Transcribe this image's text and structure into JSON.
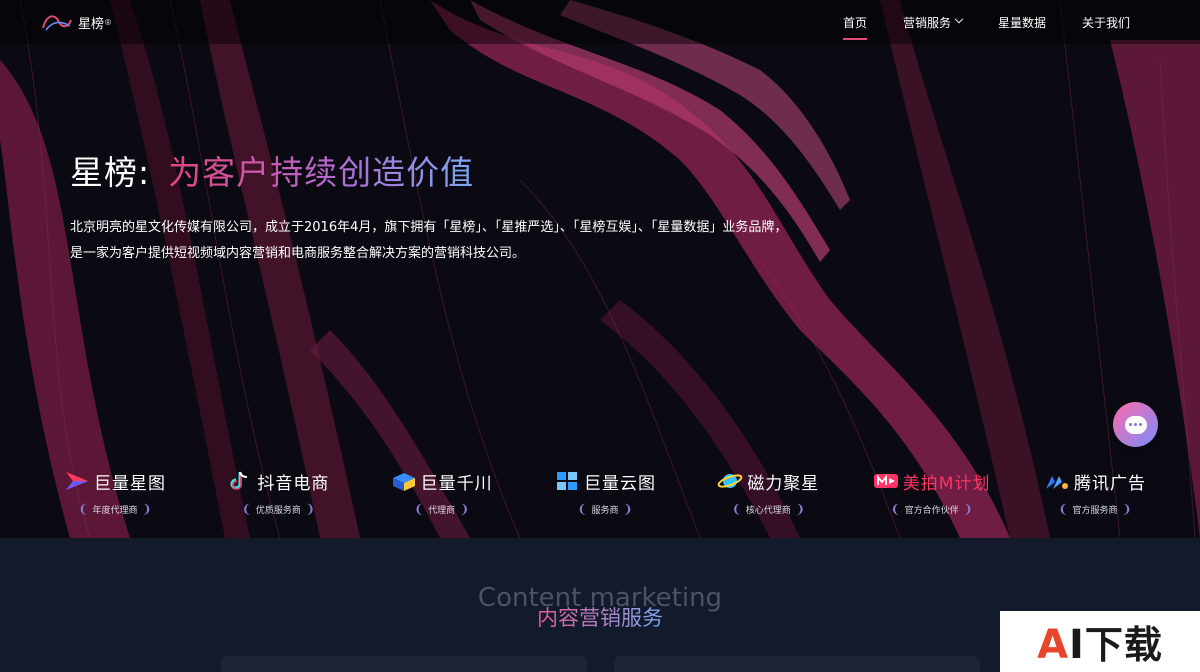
{
  "nav": {
    "logo_text": "星榜",
    "logo_sup": "®",
    "items": [
      {
        "label": "首页",
        "active": true
      },
      {
        "label": "营销服务",
        "has_dropdown": true
      },
      {
        "label": "星量数据"
      },
      {
        "label": "关于我们"
      }
    ]
  },
  "hero": {
    "title_plain": "星榜:",
    "title_gradient": "为客户持续创造价值",
    "desc_line1": "北京明亮的星文化传媒有限公司，成立于2016年4月，旗下拥有「星榜」、「星推严选」、「星榜互娱」、「星量数据」业务品牌，",
    "desc_line2": "是一家为客户提供短视频域内容营销和电商服务整合解决方案的营销科技公司。"
  },
  "partners": [
    {
      "name": "巨量星图",
      "tag": "年度代理商",
      "icon": "xingtu-icon",
      "color": "#ff3b5b"
    },
    {
      "name": "抖音电商",
      "tag": "优质服务商",
      "icon": "douyin-icon",
      "color": "#25f4ee"
    },
    {
      "name": "巨量千川",
      "tag": "代理商",
      "icon": "qianchuan-icon",
      "color": "#3a8bff"
    },
    {
      "name": "巨量云图",
      "tag": "服务商",
      "icon": "yuntu-icon",
      "color": "#2b9bff"
    },
    {
      "name": "磁力聚星",
      "tag": "核心代理商",
      "icon": "cili-icon",
      "color": "#35c4ff"
    },
    {
      "name": "美拍M计划",
      "tag": "官方合作伙伴",
      "icon": "meipai-icon",
      "color": "#ff3366"
    },
    {
      "name": "腾讯广告",
      "tag": "官方服务商",
      "icon": "tencent-ads-icon",
      "color": "#2e7bff"
    }
  ],
  "chat": {
    "icon": "chat-bubble-icon"
  },
  "section": {
    "title_en": "Content marketing",
    "title_cn": "内容营销服务"
  },
  "watermark": {
    "a": "A",
    "i": "I",
    "cn": "下载"
  },
  "colors": {
    "accent": "#e04c76",
    "bg_dark": "#0b0b14",
    "section_bg": "#121a2b"
  }
}
